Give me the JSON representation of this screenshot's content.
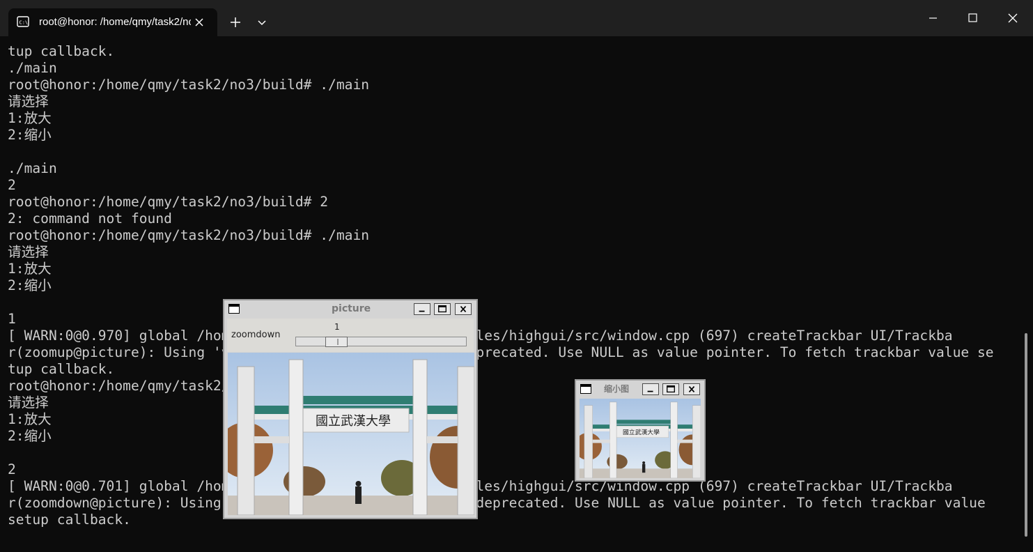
{
  "tab": {
    "title": "root@honor: /home/qmy/task2/no3/build",
    "icon": "terminal-icon"
  },
  "titlebar_icons": {
    "close_tab": "close-icon",
    "new_tab": "plus-icon",
    "dropdown": "chevron-down-icon",
    "minimize": "minimize-icon",
    "maximize": "maximize-icon",
    "close": "close-icon"
  },
  "terminal": {
    "lines": [
      "tup callback.",
      "./main",
      "root@honor:/home/qmy/task2/no3/build# ./main",
      "请选择",
      "1:放大",
      "2:缩小",
      "",
      "./main",
      "2",
      "root@honor:/home/qmy/task2/no3/build# 2",
      "2: command not found",
      "root@honor:/home/qmy/task2/no3/build# ./main",
      "请选择",
      "1:放大",
      "2:缩小",
      "",
      "1",
      "[ WARN:0@0.970] global /home/qmy/opencv/opencv-4.8.0/modules/highgui/src/window.cpp (697) createTrackbar UI/Trackba",
      "r(zoomup@picture): Using 'value' pointer is unsafe and deprecated. Use NULL as value pointer. To fetch trackbar value se",
      "tup callback.",
      "root@honor:/home/qmy/task2/no3/build# ./main",
      "请选择",
      "1:放大",
      "2:缩小",
      "",
      "2",
      "[ WARN:0@0.701] global /home/qmy/opencv/opencv-4.8.0/modules/highgui/src/window.cpp (697) createTrackbar UI/Trackba",
      "r(zoomdown@picture): Using 'value' pointer is unsafe and deprecated. Use NULL as value pointer. To fetch trackbar value",
      "setup callback."
    ]
  },
  "picture_window": {
    "title": "picture",
    "trackbar": {
      "label": "zoomdown",
      "value": "1",
      "position_fraction": 0.2
    },
    "image_caption": "國立武漢大學"
  },
  "small_window": {
    "title": "缩小图",
    "image_caption": "國立武漢大學"
  },
  "colors": {
    "terminal_bg": "#0c0c0c",
    "terminal_text": "#cccccc",
    "titlebar_bg": "#202020",
    "highgui_frame": "#d4d4d4",
    "sky": "#b9cfe6",
    "tile_green": "#2f7d72"
  }
}
